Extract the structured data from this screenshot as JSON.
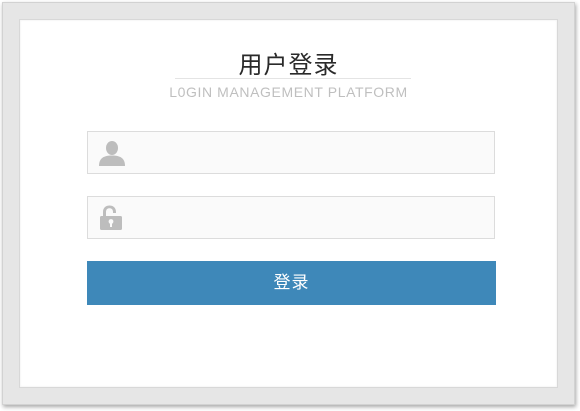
{
  "header": {
    "title": "用户登录",
    "subtitle": "L0GIN MANAGEMENT PLATFORM"
  },
  "form": {
    "username": {
      "icon": "user-icon",
      "value": "",
      "placeholder": ""
    },
    "password": {
      "icon": "lock-icon",
      "value": "",
      "placeholder": ""
    },
    "submit_label": "登录"
  },
  "colors": {
    "accent": "#3e88b9",
    "icon_gray": "#bdbdbd",
    "frame_gray": "#e6e6e6"
  }
}
